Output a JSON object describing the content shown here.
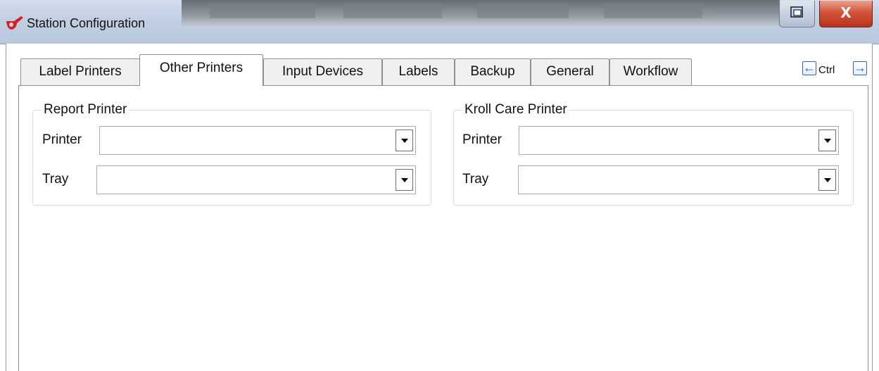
{
  "window": {
    "title": "Station Configuration",
    "close_glyph": "X"
  },
  "tabs": [
    {
      "label": "Label Printers",
      "active": false
    },
    {
      "label": "Other Printers",
      "active": true
    },
    {
      "label": "Input Devices",
      "active": false
    },
    {
      "label": "Labels",
      "active": false
    },
    {
      "label": "Backup",
      "active": false
    },
    {
      "label": "General",
      "active": false
    },
    {
      "label": "Workflow",
      "active": false
    }
  ],
  "nav": {
    "prev_icon": "arrow-left-icon",
    "next_icon": "arrow-right-icon",
    "label": "Ctrl"
  },
  "report_group": {
    "title": "Report Printer",
    "printer_label": "Printer",
    "printer_value": "",
    "tray_label": "Tray",
    "tray_value": ""
  },
  "kroll_group": {
    "title": "Kroll Care Printer",
    "printer_label": "Printer",
    "printer_value": "",
    "tray_label": "Tray",
    "tray_value": ""
  },
  "colors": {
    "nav_arrow": "#1560d8",
    "close_button": "#c6452b",
    "titlebar": "#c2cfe3"
  }
}
